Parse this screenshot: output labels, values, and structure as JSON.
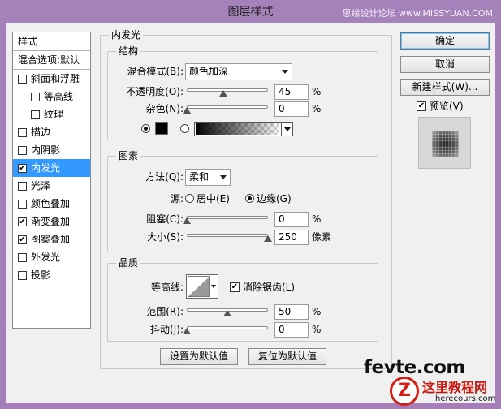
{
  "window": {
    "title": "图层样式",
    "watermark": "思缘设计论坛 www.MISSYUAN.COM"
  },
  "style_list": {
    "header": "样式",
    "blend_options": "混合选项:默认",
    "items": [
      {
        "label": "斜面和浮雕",
        "checked": false
      },
      {
        "label": "等高线",
        "checked": false
      },
      {
        "label": "纹理",
        "checked": false
      },
      {
        "label": "描边",
        "checked": false
      },
      {
        "label": "内阴影",
        "checked": false
      },
      {
        "label": "内发光",
        "checked": true,
        "selected": true
      },
      {
        "label": "光泽",
        "checked": false
      },
      {
        "label": "颜色叠加",
        "checked": false
      },
      {
        "label": "渐变叠加",
        "checked": true
      },
      {
        "label": "图案叠加",
        "checked": true
      },
      {
        "label": "外发光",
        "checked": false
      },
      {
        "label": "投影",
        "checked": false
      }
    ]
  },
  "inner_glow": {
    "title": "内发光",
    "structure": {
      "title": "结构",
      "blend_mode_label": "混合模式(B):",
      "blend_mode_value": "颜色加深",
      "opacity_label": "不透明度(O):",
      "opacity_value": "45",
      "opacity_fraction": 0.45,
      "noise_label": "杂色(N):",
      "noise_value": "0",
      "noise_fraction": 0.0,
      "unit": "%",
      "color_mode": "solid",
      "glow_color": "#000000"
    },
    "elements": {
      "title": "图素",
      "technique_label": "方法(Q):",
      "technique_value": "柔和",
      "source_label": "源:",
      "source_center": "居中(E)",
      "source_edge": "边缘(G)",
      "source_selected": "edge",
      "choke_label": "阻塞(C):",
      "choke_value": "0",
      "choke_fraction": 0.0,
      "size_label": "大小(S):",
      "size_value": "250",
      "size_fraction": 1.0,
      "size_unit": "像素",
      "unit": "%"
    },
    "quality": {
      "title": "品质",
      "contour_label": "等高线:",
      "antialias_label": "消除锯齿(L)",
      "antialias_checked": true,
      "range_label": "范围(R):",
      "range_value": "50",
      "range_fraction": 0.5,
      "jitter_label": "抖动(J):",
      "jitter_value": "0",
      "jitter_fraction": 0.0,
      "unit": "%"
    },
    "make_default": "设置为默认值",
    "reset_default": "复位为默认值"
  },
  "buttons": {
    "ok": "确定",
    "cancel": "取消",
    "new_style": "新建样式(W)...",
    "preview_label": "预览(V)",
    "preview_checked": true
  },
  "logos": {
    "fevte": "fevte.com",
    "site_name": "这里教程网",
    "site_url": "herecours.com",
    "badge_letter": "Z"
  }
}
